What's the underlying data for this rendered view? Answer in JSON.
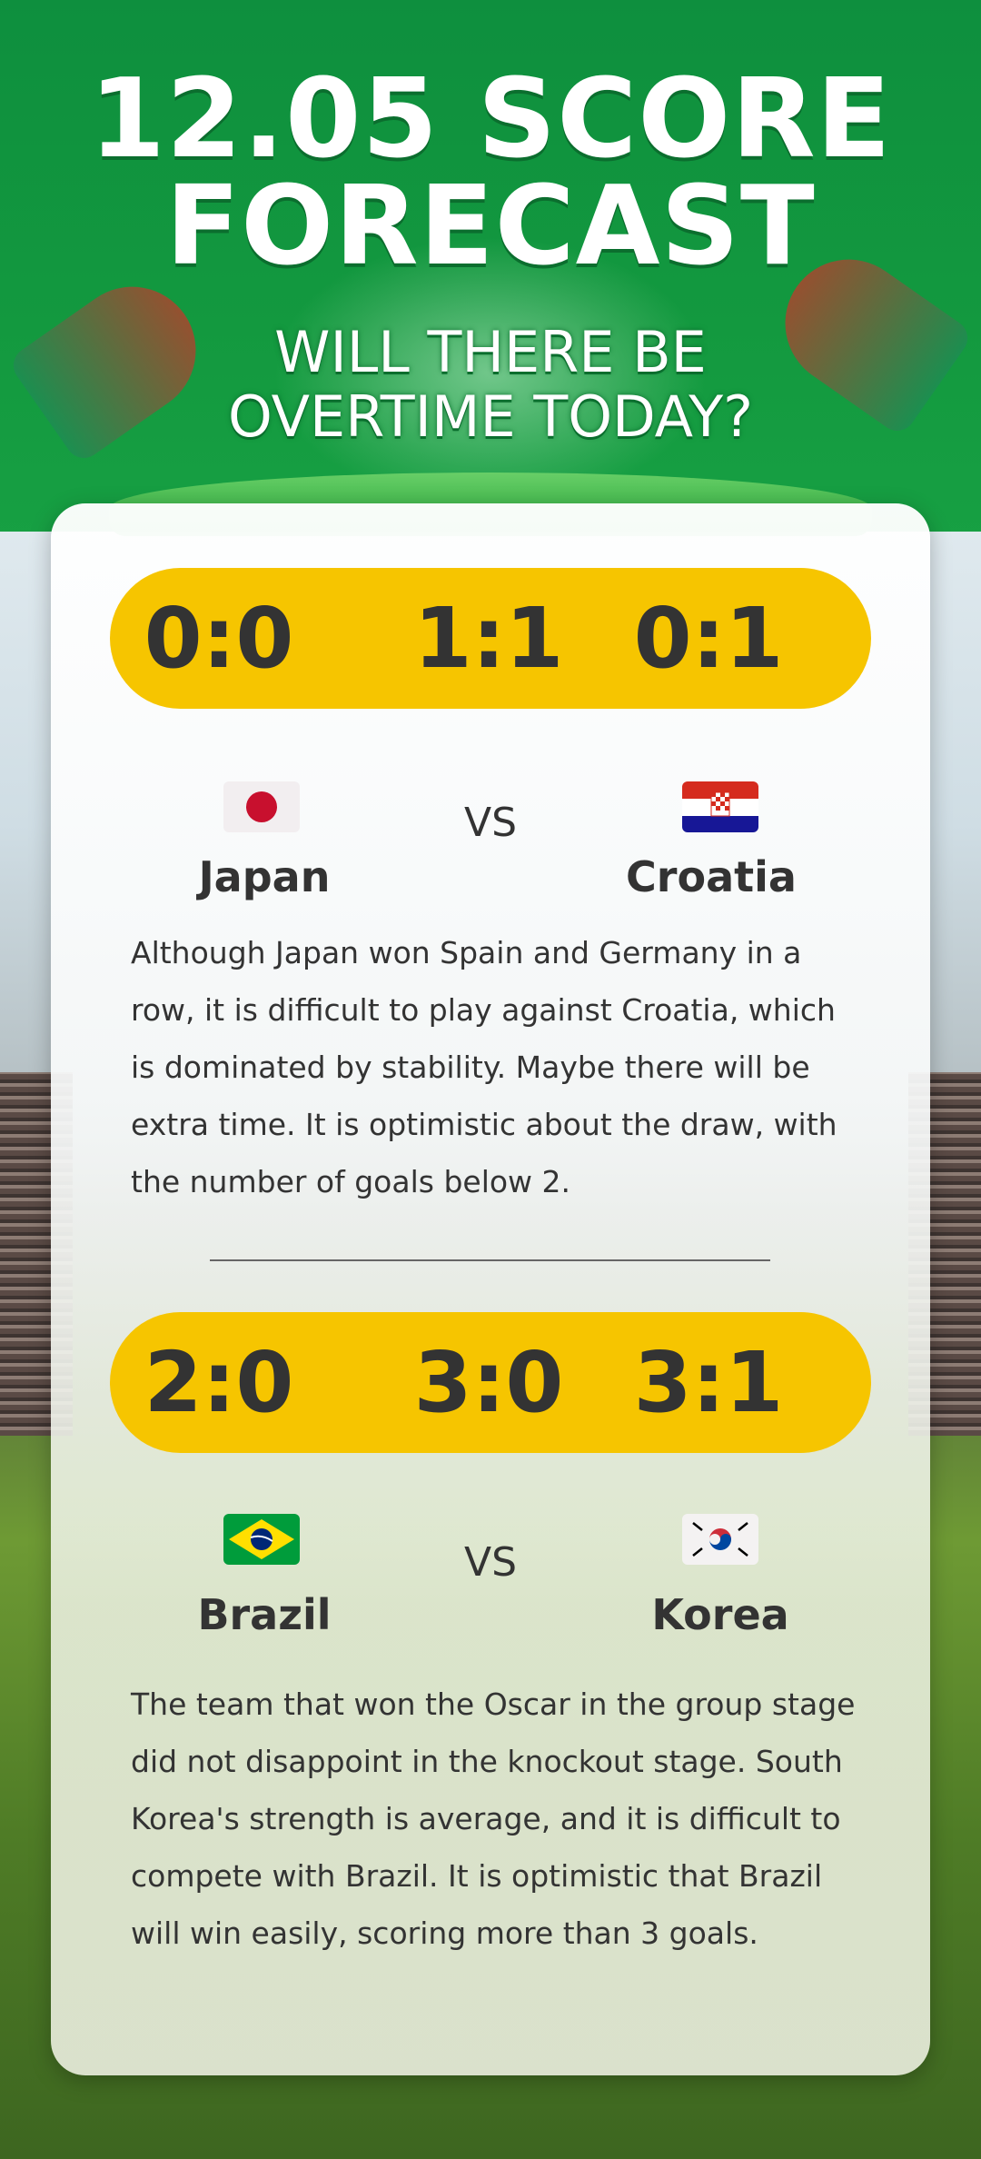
{
  "header": {
    "title_line1": "12.05 SCORE",
    "title_line2": "FORECAST",
    "subtitle_line1": "WILL THERE BE",
    "subtitle_line2": "OVERTIME TODAY?"
  },
  "matches": [
    {
      "scores": [
        "0:0",
        "1:1",
        "0:1"
      ],
      "home": "Japan",
      "vs": "VS",
      "away": "Croatia",
      "description": "Although Japan won Spain and Germany in a row, it is difficult to play against Croatia, which is dominated by stability. Maybe there will be extra time. It is optimistic about the draw, with the number of goals below 2."
    },
    {
      "scores": [
        "2:0",
        "3:0",
        "3:1"
      ],
      "home": "Brazil",
      "vs": "VS",
      "away": "Korea",
      "description": "The team that won the Oscar in the group stage did not disappoint in the knockout stage. South Korea's strength is average, and it is difficult to compete with Brazil. It is optimistic that Brazil will win easily, scoring more than 3 goals."
    }
  ],
  "colors": {
    "header_green": "#13993f",
    "score_pill": "#f6c500",
    "text_dark": "#333333"
  }
}
